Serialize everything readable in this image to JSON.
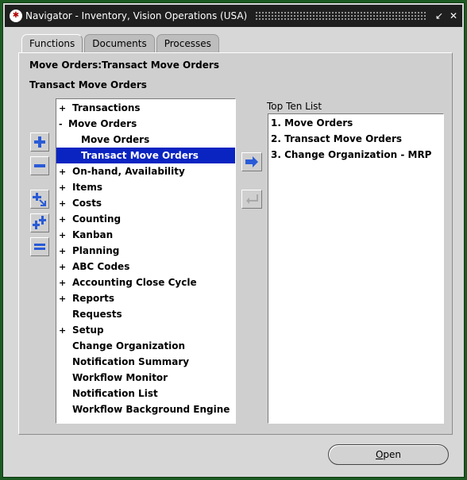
{
  "window": {
    "title": "Navigator - Inventory, Vision Operations (USA)",
    "logo_glyph": "✱",
    "minimize_glyph": "↙",
    "close_glyph": "✕"
  },
  "tabs": [
    {
      "label": "Functions",
      "active": true
    },
    {
      "label": "Documents",
      "active": false
    },
    {
      "label": "Processes",
      "active": false
    }
  ],
  "breadcrumb": "Move Orders:Transact Move Orders",
  "current_function": "Transact Move Orders",
  "tree": {
    "rows": [
      {
        "label": "Transactions",
        "expander": "+",
        "level": 0
      },
      {
        "label": "Move Orders",
        "expander": "-",
        "level": 0
      },
      {
        "label": "Move Orders",
        "expander": "",
        "level": 1
      },
      {
        "label": "Transact Move Orders",
        "expander": "",
        "level": 1,
        "selected": true
      },
      {
        "label": "On-hand, Availability",
        "expander": "+",
        "level": 0
      },
      {
        "label": "Items",
        "expander": "+",
        "level": 0
      },
      {
        "label": "Costs",
        "expander": "+",
        "level": 0
      },
      {
        "label": "Counting",
        "expander": "+",
        "level": 0
      },
      {
        "label": "Kanban",
        "expander": "+",
        "level": 0
      },
      {
        "label": "Planning",
        "expander": "+",
        "level": 0
      },
      {
        "label": "ABC Codes",
        "expander": "+",
        "level": 0
      },
      {
        "label": "Accounting Close Cycle",
        "expander": "+",
        "level": 0
      },
      {
        "label": "Reports",
        "expander": "+",
        "level": 0
      },
      {
        "label": "Requests",
        "expander": "",
        "level": 0
      },
      {
        "label": "Setup",
        "expander": "+",
        "level": 0
      },
      {
        "label": "Change Organization",
        "expander": "",
        "level": 0
      },
      {
        "label": "Notification Summary",
        "expander": "",
        "level": 0
      },
      {
        "label": "Workflow Monitor",
        "expander": "",
        "level": 0
      },
      {
        "label": "Notification List",
        "expander": "",
        "level": 0
      },
      {
        "label": "Workflow Background Engine",
        "expander": "",
        "level": 0
      }
    ]
  },
  "side_buttons": [
    {
      "icon": "expand-icon"
    },
    {
      "icon": "collapse-icon"
    },
    {
      "icon": "expand-branch-icon"
    },
    {
      "icon": "expand-all-icon"
    },
    {
      "icon": "collapse-all-icon"
    }
  ],
  "top_ten": {
    "label": "Top Ten List",
    "items": [
      "1. Move Orders",
      "2. Transact Move Orders",
      "3. Change Organization - MRP"
    ]
  },
  "buttons": {
    "open_access_key": "O",
    "open_rest": "pen"
  },
  "colors": {
    "window_border": "#1d5b22",
    "titlebar": "#1f1f1f",
    "panel": "#cfcfcf",
    "selection": "#0a24c2",
    "icon_blue": "#2a5bd7"
  }
}
